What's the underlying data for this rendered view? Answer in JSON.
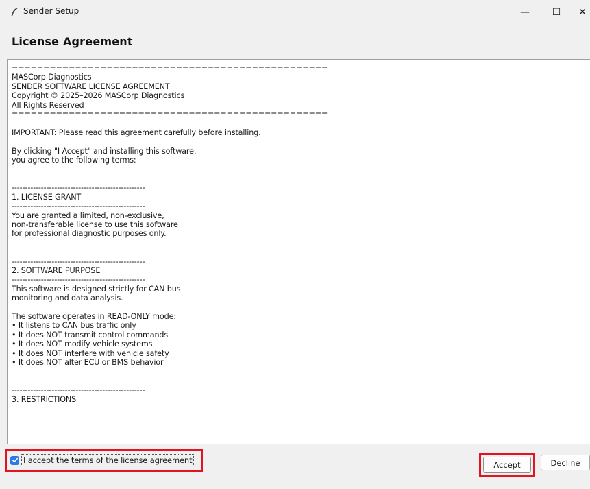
{
  "window": {
    "title": "Sender Setup",
    "minimize_glyph": "—",
    "maximize_glyph": "☐",
    "close_glyph": "✕",
    "icon": "feather-icon"
  },
  "header": {
    "title": "License Agreement"
  },
  "license": {
    "lines": [
      "==================================================",
      "MASCorp Diagnostics",
      "SENDER SOFTWARE LICENSE AGREEMENT",
      "Copyright © 2025–2026 MASCorp Diagnostics",
      "All Rights Reserved",
      "==================================================",
      "",
      "IMPORTANT: Please read this agreement carefully before installing.",
      "",
      "By clicking \"I Accept\" and installing this software,",
      "you agree to the following terms:",
      "",
      "",
      "--------------------------------------------------",
      "1. LICENSE GRANT",
      "--------------------------------------------------",
      "You are granted a limited, non-exclusive,",
      "non-transferable license to use this software",
      "for professional diagnostic purposes only.",
      "",
      "",
      "--------------------------------------------------",
      "2. SOFTWARE PURPOSE",
      "--------------------------------------------------",
      "This software is designed strictly for CAN bus",
      "monitoring and data analysis.",
      "",
      "The software operates in READ-ONLY mode:",
      "• It listens to CAN bus traffic only",
      "• It does NOT transmit control commands",
      "• It does NOT modify vehicle systems",
      "• It does NOT interfere with vehicle safety",
      "• It does NOT alter ECU or BMS behavior",
      "",
      "",
      "--------------------------------------------------",
      "3. RESTRICTIONS"
    ]
  },
  "accept_checkbox": {
    "label": "I accept the terms of the license agreement",
    "checked": true
  },
  "buttons": {
    "accept": "Accept",
    "decline": "Decline"
  },
  "colors": {
    "highlight_border": "#e3141f",
    "checkbox_fill": "#2c7be5"
  }
}
